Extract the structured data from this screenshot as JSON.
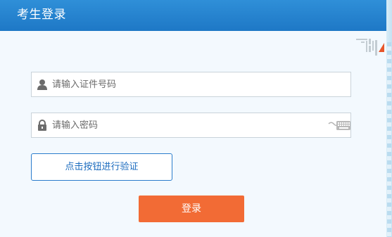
{
  "header": {
    "title": "考生登录"
  },
  "form": {
    "username_placeholder": "请输入证件号码",
    "password_placeholder": "请输入密码",
    "verify_label": "点击按钮进行验证",
    "submit_label": "登录"
  },
  "icons": {
    "username": "user-icon",
    "password": "lock-icon",
    "keyboard": "keyboard-icon",
    "qr_switch": "qr-code-icon"
  },
  "colors": {
    "header": "#1e78c6",
    "submit_button": "#f26b35",
    "verify_border": "#2a7ccc",
    "panel_background": "#f3f9fe"
  }
}
